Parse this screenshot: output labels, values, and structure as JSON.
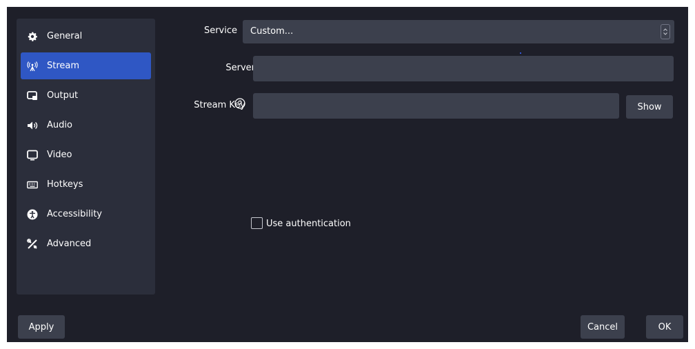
{
  "sidebar": {
    "items": [
      {
        "label": "General",
        "icon": "gear-icon"
      },
      {
        "label": "Stream",
        "icon": "antenna-icon",
        "active": true
      },
      {
        "label": "Output",
        "icon": "output-icon"
      },
      {
        "label": "Audio",
        "icon": "speaker-icon"
      },
      {
        "label": "Video",
        "icon": "monitor-icon"
      },
      {
        "label": "Hotkeys",
        "icon": "keyboard-icon"
      },
      {
        "label": "Accessibility",
        "icon": "accessibility-icon"
      },
      {
        "label": "Advanced",
        "icon": "tools-icon"
      }
    ]
  },
  "form": {
    "service_label": "Service",
    "service_value": "Custom...",
    "server_label": "Server",
    "server_value": "",
    "stream_key_label": "Stream Key",
    "stream_key_value": "",
    "show_button": "Show",
    "use_auth_label": "Use authentication",
    "use_auth_checked": false
  },
  "footer": {
    "apply": "Apply",
    "cancel": "Cancel",
    "ok": "OK"
  },
  "colors": {
    "background": "#1e1f29",
    "sidebar": "#2b2e3b",
    "accent": "#2f57c4",
    "input": "#3c404d"
  }
}
